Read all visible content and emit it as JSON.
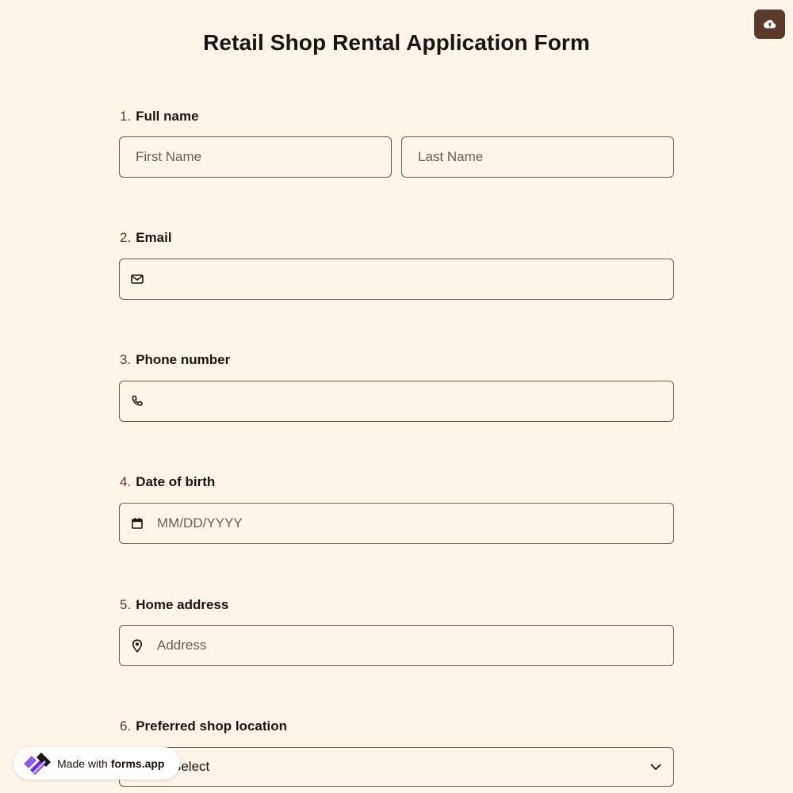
{
  "form": {
    "title": "Retail Shop Rental Application Form"
  },
  "upload": {
    "icon": "cloud-upload-icon"
  },
  "questions": [
    {
      "number": "1.",
      "label": "Full name"
    },
    {
      "number": "2.",
      "label": "Email"
    },
    {
      "number": "3.",
      "label": "Phone number"
    },
    {
      "number": "4.",
      "label": "Date of birth"
    },
    {
      "number": "5.",
      "label": "Home address"
    },
    {
      "number": "6.",
      "label": "Preferred shop location"
    }
  ],
  "fields": {
    "first_name": {
      "placeholder": "First Name",
      "value": ""
    },
    "last_name": {
      "placeholder": "Last Name",
      "value": ""
    },
    "email": {
      "placeholder": "",
      "value": "",
      "icon": "envelope-icon"
    },
    "phone": {
      "placeholder": "",
      "value": "",
      "icon": "phone-icon"
    },
    "dob": {
      "placeholder": "MM/DD/YYYY",
      "value": "",
      "icon": "calendar-icon"
    },
    "address": {
      "placeholder": "Address",
      "value": "",
      "icon": "map-pin-icon"
    },
    "shop_location": {
      "selected": "Select",
      "icon": "chevron-down-icon"
    }
  },
  "badge": {
    "made_with": "Made with",
    "brand": "forms.app"
  },
  "colors": {
    "background": "#fdf5e9",
    "accent": "#5a3a2a",
    "text": "#1c1410",
    "border": "#6b5648"
  }
}
